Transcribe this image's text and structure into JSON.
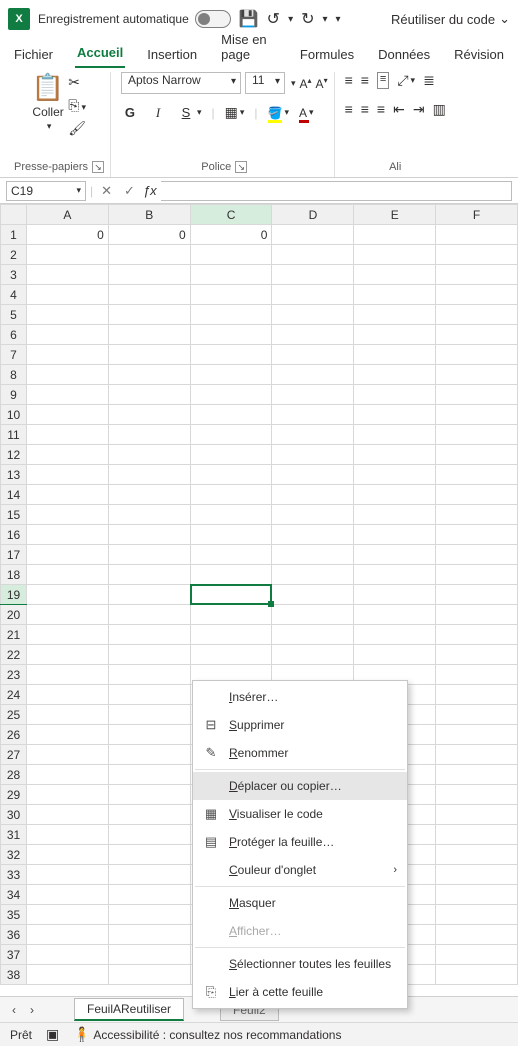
{
  "titlebar": {
    "autosave_label": "Enregistrement automatique",
    "reuse_code_label": "Réutiliser du code"
  },
  "tabs": [
    "Fichier",
    "Accueil",
    "Insertion",
    "Mise en page",
    "Formules",
    "Données",
    "Révision"
  ],
  "active_tab_index": 1,
  "ribbon": {
    "clipboard": {
      "paste": "Coller",
      "group_label": "Presse-papiers"
    },
    "font": {
      "name": "Aptos Narrow",
      "size": "11",
      "bold": "G",
      "italic": "I",
      "underline": "S",
      "font_letter": "A",
      "group_label": "Police"
    },
    "alignment": {
      "group_label": "Ali"
    }
  },
  "namebox": "C19",
  "columns": [
    "A",
    "B",
    "C",
    "D",
    "E",
    "F"
  ],
  "selected_col": "C",
  "selected_row": 19,
  "formula_value": "",
  "cells": {
    "A1": "0",
    "B1": "0",
    "C1": "0"
  },
  "context_menu": [
    {
      "label": "Insérer…",
      "icon": ""
    },
    {
      "label": "Supprimer",
      "icon": "⊟"
    },
    {
      "label": "Renommer",
      "icon": "✎"
    },
    {
      "label": "Déplacer ou copier…",
      "icon": "",
      "highlighted": true
    },
    {
      "label": "Visualiser le code",
      "icon": "▦"
    },
    {
      "label": "Protéger la feuille…",
      "icon": "▤"
    },
    {
      "label": "Couleur d'onglet",
      "icon": "",
      "submenu": true
    },
    {
      "label": "Masquer",
      "icon": ""
    },
    {
      "label": "Afficher…",
      "icon": "",
      "disabled": true
    },
    {
      "label": "Sélectionner toutes les feuilles",
      "icon": ""
    },
    {
      "label": "Lier à cette feuille",
      "icon": "⎘"
    }
  ],
  "sheets": {
    "active": "FeuilAReutiliser",
    "other": "Feuil2"
  },
  "statusbar": {
    "ready": "Prêt",
    "accessibility": "Accessibilité : consultez nos recommandations"
  }
}
